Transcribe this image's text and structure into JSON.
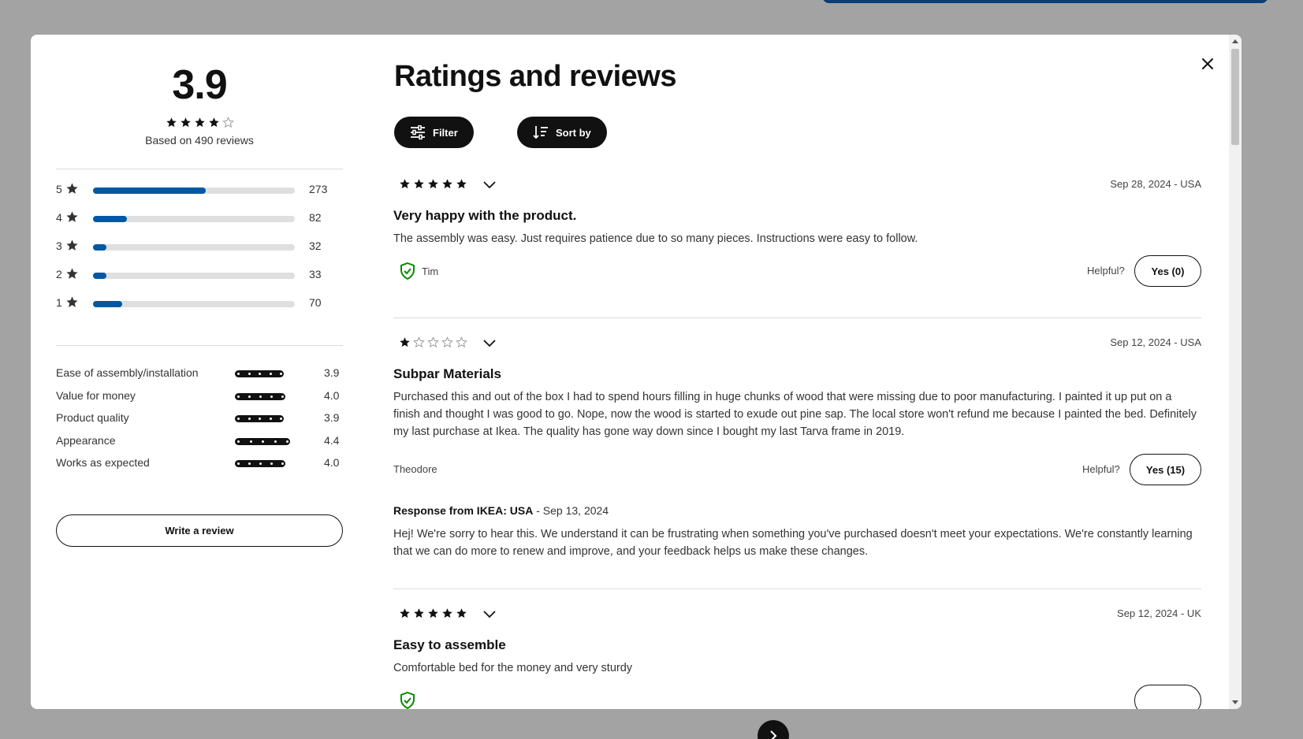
{
  "summary": {
    "average": "3.9",
    "average_stars": 4,
    "based_on": "Based on 490 reviews",
    "distribution": [
      {
        "stars": "5",
        "count": "273",
        "fraction": 0.557
      },
      {
        "stars": "4",
        "count": "82",
        "fraction": 0.167
      },
      {
        "stars": "3",
        "count": "32",
        "fraction": 0.065
      },
      {
        "stars": "2",
        "count": "33",
        "fraction": 0.067
      },
      {
        "stars": "1",
        "count": "70",
        "fraction": 0.143
      }
    ],
    "attributes": [
      {
        "label": "Ease of assembly/installation",
        "value": "3.9",
        "score": 3.9
      },
      {
        "label": "Value for money",
        "value": "4.0",
        "score": 4.0
      },
      {
        "label": "Product quality",
        "value": "3.9",
        "score": 3.9
      },
      {
        "label": "Appearance",
        "value": "4.4",
        "score": 4.4
      },
      {
        "label": "Works as expected",
        "value": "4.0",
        "score": 4.0
      }
    ],
    "write_review_label": "Write a review"
  },
  "header": {
    "title": "Ratings and reviews",
    "filter_label": "Filter",
    "sort_label": "Sort by"
  },
  "reviews": [
    {
      "stars": 5,
      "date": "Sep 28, 2024 - USA",
      "title": "Very happy with the product.",
      "text": "The assembly was easy. Just requires patience due to so many pieces. Instructions were easy to follow.",
      "author": "Tim",
      "verified": true,
      "helpful_label": "Helpful?",
      "yes_label": "Yes (0)"
    },
    {
      "stars": 1,
      "date": "Sep 12, 2024 - USA",
      "title": "Subpar Materials",
      "text": "Purchased this and out of the box I had to spend hours filling in huge chunks of wood that were missing due to poor manufacturing. I painted it up put on a finish and thought I was good to go. Nope, now the wood is started to exude out pine sap. The local store won't refund me because I painted the bed. Definitely my last purchase at Ikea. The quality has gone way down since I bought my last Tarva frame in 2019.",
      "author": "Theodore",
      "verified": false,
      "helpful_label": "Helpful?",
      "yes_label": "Yes (15)",
      "response": {
        "from": "Response from IKEA: USA",
        "date": " - Sep 13, 2024",
        "text": "Hej! We're sorry to hear this. We understand it can be frustrating when something you've purchased doesn't meet your expectations. We're constantly learning that we can do more to renew and improve, and your feedback helps us make these changes."
      }
    },
    {
      "stars": 5,
      "date": "Sep 12, 2024 - UK",
      "title": "Easy to assemble",
      "text": "Comfortable bed for the money and very sturdy",
      "verified": true
    }
  ],
  "colors": {
    "accent_blue": "#0058a3",
    "verified_green": "#0a8a00",
    "backdrop": "#a3a3a3"
  }
}
